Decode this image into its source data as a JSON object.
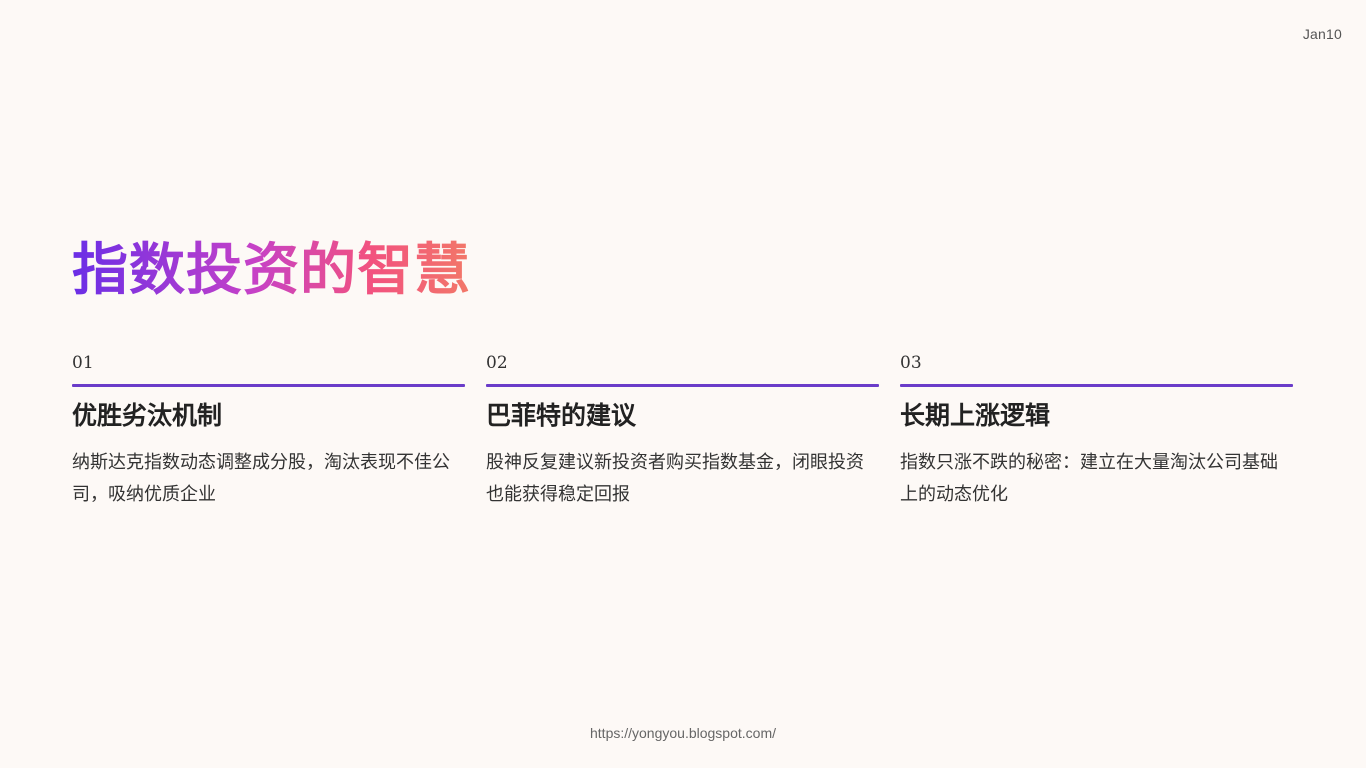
{
  "header": {
    "date": "Jan10"
  },
  "title": "指数投资的智慧",
  "cards": [
    {
      "number": "01",
      "heading": "优胜劣汰机制",
      "body": "纳斯达克指数动态调整成分股，淘汰表现不佳公司，吸纳优质企业"
    },
    {
      "number": "02",
      "heading": "巴菲特的建议",
      "body": "股神反复建议新投资者购买指数基金，闭眼投资也能获得稳定回报"
    },
    {
      "number": "03",
      "heading": "长期上涨逻辑",
      "body": "指数只涨不跌的秘密：建立在大量淘汰公司基础上的动态优化"
    }
  ],
  "footer": {
    "url": "https://yongyou.blogspot.com/"
  },
  "colors": {
    "background": "#fdf9f6",
    "accent_rule": "#6a3cc9",
    "title_gradient_start": "#6a2ee6",
    "title_gradient_end": "#f27868"
  }
}
